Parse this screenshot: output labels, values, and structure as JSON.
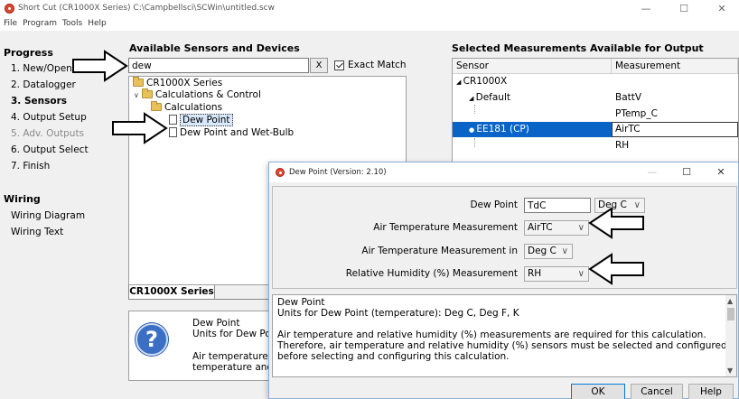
{
  "window": {
    "title": "Short Cut (CR1000X Series) C:\\Campbellsci\\SCWin\\untitled.scw",
    "minimize": "—",
    "maximize": "☐",
    "close": "✕"
  },
  "menu": [
    "File",
    "Program",
    "Tools",
    "Help"
  ],
  "progress": {
    "heading": "Progress",
    "steps": [
      "1. New/Open",
      "2. Datalogger",
      "3. Sensors",
      "4. Output Setup",
      "5. Adv. Outputs",
      "6. Output Select",
      "7. Finish"
    ],
    "current_step": "3. Sensors",
    "disabled_step": "5. Adv. Outputs"
  },
  "wiring": {
    "heading": "Wiring",
    "items": [
      "Wiring Diagram",
      "Wiring Text"
    ]
  },
  "sensors": {
    "title": "Available Sensors and Devices",
    "search_value": "dew",
    "clear_label": "X",
    "exact_match_label": "Exact Match",
    "exact_match_checked": true,
    "tree": [
      {
        "label": "CR1000X Series",
        "type": "folder",
        "level": 0
      },
      {
        "label": "Calculations & Control",
        "type": "folder",
        "level": 1,
        "expanded": true
      },
      {
        "label": "Calculations",
        "type": "folder",
        "level": 2
      },
      {
        "label": "Dew Point",
        "type": "item",
        "level": 3,
        "selected": true
      },
      {
        "label": "Dew Point and Wet-Bulb",
        "type": "item",
        "level": 3
      }
    ],
    "tab_label": "CR1000X Series",
    "help_lines": [
      "Dew Point",
      "Units for Dew Po",
      "Air temperature",
      "temperature and"
    ]
  },
  "selected_measurements": {
    "title": "Selected Measurements Available for Output",
    "columns": [
      "Sensor",
      "Measurement"
    ],
    "rows": [
      {
        "sensor": "CR1000X",
        "measurement": ""
      },
      {
        "sensor": "Default",
        "measurement": "BattV"
      },
      {
        "sensor": "",
        "measurement": "PTemp_C"
      },
      {
        "sensor": "EE181 (CP)",
        "measurement": "AirTC",
        "selected": true
      },
      {
        "sensor": "",
        "measurement": "RH"
      }
    ]
  },
  "dialog": {
    "title": "Dew Point (Version: 2.10)",
    "minimize": "—",
    "maximize": "☐",
    "close": "✕",
    "fields": {
      "dew_point_label": "Dew Point",
      "dew_point_value": "TdC",
      "dew_point_unit": "Deg C",
      "air_temp_label": "Air Temperature Measurement",
      "air_temp_value": "AirTC",
      "air_temp_in_label": "Air Temperature Measurement in",
      "air_temp_in_value": "Deg C",
      "rh_label": "Relative Humidity (%) Measurement",
      "rh_value": "RH"
    },
    "description": [
      "Dew Point",
      "Units for Dew Point (temperature): Deg C, Deg F, K",
      "",
      "Air temperature and relative humidity (%) measurements are required for this calculation.",
      "Therefore, air temperature and relative humidity (%) sensors must be selected and configured",
      "before selecting and configuring this calculation."
    ],
    "buttons": {
      "ok": "OK",
      "cancel": "Cancel",
      "help": "Help"
    }
  },
  "icons": {
    "app": "app-logo-icon",
    "folder": "folder-icon",
    "document": "document-icon",
    "help": "question-mark-icon",
    "dropdown": "chevron-down-icon"
  },
  "colors": {
    "selection": "#0a64c8",
    "help_icon": "#3a6fc4",
    "app_icon": "#d9482b"
  }
}
